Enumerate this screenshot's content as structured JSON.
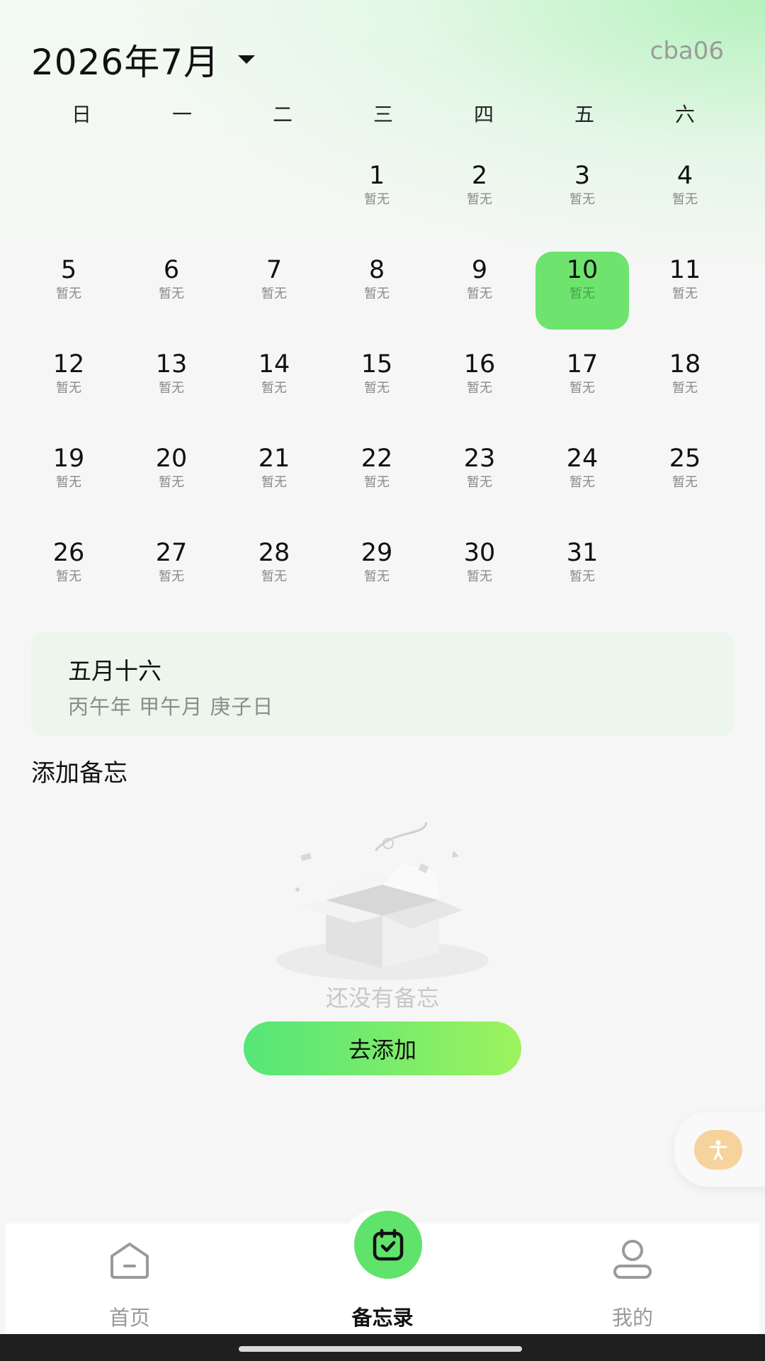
{
  "header": {
    "month_title": "2026年7月",
    "username": "cba06"
  },
  "calendar": {
    "weekdays": [
      "日",
      "一",
      "二",
      "三",
      "四",
      "五",
      "六"
    ],
    "first_weekday_index": 3,
    "days_in_month": 31,
    "selected_day": 10,
    "day_sub_label": "暂无",
    "selected_color": "#6ee46f"
  },
  "lunar": {
    "date": "五月十六",
    "ganzhi": "丙午年 甲午月 庚子日"
  },
  "memo": {
    "section_title": "添加备忘",
    "empty_text": "还没有备忘",
    "add_button_label": "去添加"
  },
  "bottom_nav": {
    "items": [
      {
        "label": "首页",
        "icon": "home-icon",
        "active": false
      },
      {
        "label": "备忘录",
        "icon": "memo-check-icon",
        "active": true
      },
      {
        "label": "我的",
        "icon": "profile-icon",
        "active": false
      }
    ]
  },
  "colors": {
    "accent_green": "#5fe36b",
    "float_button": "#f6d39c"
  }
}
